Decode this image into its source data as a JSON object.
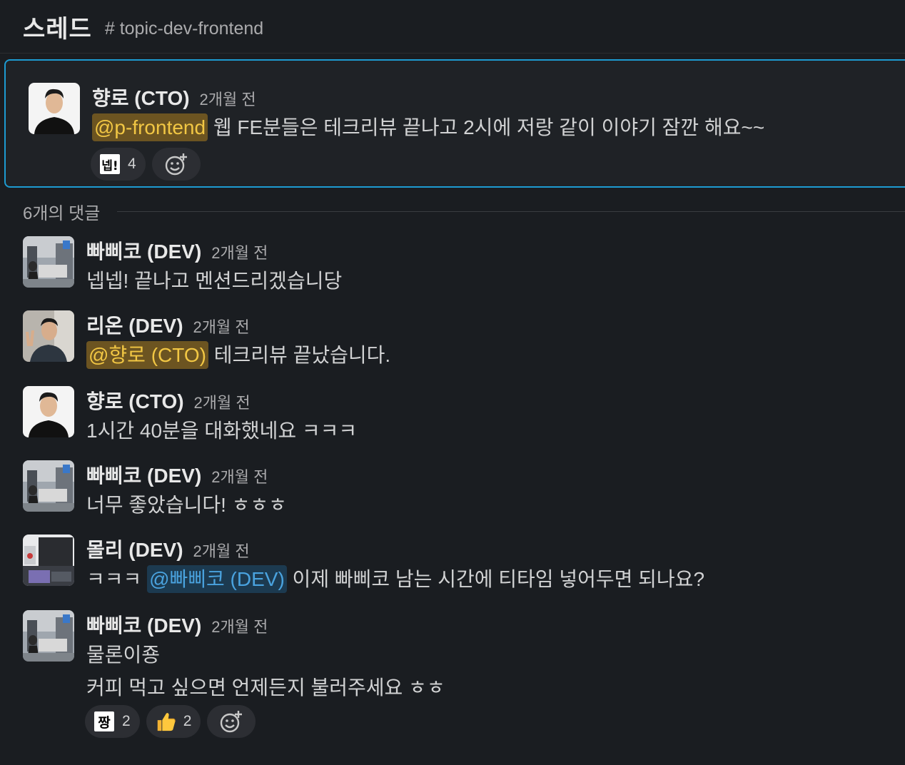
{
  "header": {
    "title": "스레드",
    "channel": "# topic-dev-frontend"
  },
  "parent": {
    "author": "향로 (CTO)",
    "time": "2개월 전",
    "mention": "@p-frontend",
    "text": " 웹 FE분들은 테크리뷰 끝나고 2시에 저랑 같이 이야기 잠깐 해요~~",
    "reactions": [
      {
        "emoji": "넵-emoji",
        "label": "넵!",
        "count": "4"
      }
    ]
  },
  "replies_label": "6개의 댓글",
  "messages": [
    {
      "author": "빠삐코 (DEV)",
      "time": "2개월 전",
      "text": "넵넵! 끝나고 멘션드리겠습니당"
    },
    {
      "author": "리온 (DEV)",
      "time": "2개월 전",
      "mention": "@향로 (CTO)",
      "text": " 테크리뷰 끝났습니다."
    },
    {
      "author": "향로 (CTO)",
      "time": "2개월 전",
      "text": "1시간 40분을 대화했네요 ㅋㅋㅋ"
    },
    {
      "author": "빠삐코 (DEV)",
      "time": "2개월 전",
      "text": "너무 좋았습니다! ㅎㅎㅎ"
    },
    {
      "author": "몰리 (DEV)",
      "time": "2개월 전",
      "prefix": "ㅋㅋㅋ ",
      "mention": "@빠삐코 (DEV)",
      "text": " 이제 빠삐코 남는 시간에 티타임 넣어두면 되나요?"
    },
    {
      "author": "빠삐코 (DEV)",
      "time": "2개월 전",
      "line1": "물론이죵",
      "line2": "커피 먹고 싶으면 언제든지 불러주세요 ㅎㅎ",
      "reactions": [
        {
          "emoji": "짱-emoji",
          "label": "짱",
          "count": "2"
        },
        {
          "emoji": "thumbs-up-icon",
          "count": "2"
        }
      ]
    }
  ],
  "colors": {
    "mention_yellow_bg": "#6c5421",
    "mention_yellow_fg": "#f2c744",
    "mention_blue_bg": "#1c3a50",
    "mention_blue_fg": "#4aa3df",
    "focus_border": "#1d9bd1"
  }
}
